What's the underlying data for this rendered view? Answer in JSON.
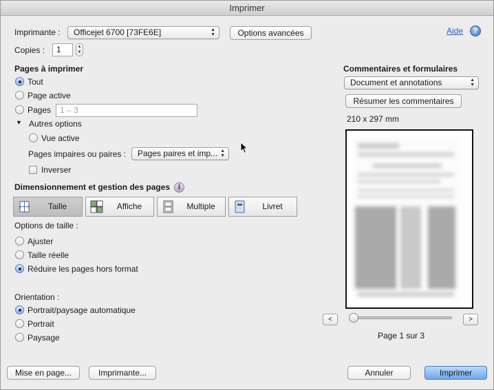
{
  "window": {
    "title": "Imprimer"
  },
  "printer": {
    "label": "Imprimante :",
    "selected": "Officejet 6700 [73FE6E]",
    "advanced_button": "Options avancées",
    "help_link": "Aide"
  },
  "copies": {
    "label": "Copies :",
    "value": "1"
  },
  "pages": {
    "heading": "Pages à imprimer",
    "all": "Tout",
    "current": "Page active",
    "range": "Pages",
    "range_placeholder": "1 – 3",
    "more_options": "Autres options",
    "active_view": "Vue active",
    "odd_even_label": "Pages impaires ou paires :",
    "odd_even_selected": "Pages paires et imp...",
    "reverse": "Inverser"
  },
  "sizing": {
    "heading": "Dimensionnement et gestion des pages",
    "modes": [
      "Taille",
      "Affiche",
      "Multiple",
      "Livret"
    ],
    "selected_mode": "Taille",
    "size_options_label": "Options de taille :",
    "fit": "Ajuster",
    "actual_size": "Taille réelle",
    "shrink_oversized": "Réduire les pages hors format"
  },
  "orientation": {
    "label": "Orientation :",
    "auto": "Portrait/paysage automatique",
    "portrait": "Portrait",
    "landscape": "Paysage"
  },
  "comments": {
    "heading": "Commentaires et formulaires",
    "selected": "Document et annotations",
    "summarize_button": "Résumer les commentaires",
    "page_size": "210 x 297 mm"
  },
  "preview": {
    "prev": "<",
    "next": ">",
    "page_status": "Page 1 sur 3",
    "current_page": 1,
    "total_pages": 3
  },
  "footer": {
    "page_setup": "Mise en page...",
    "printer": "Imprimante...",
    "cancel": "Annuler",
    "print": "Imprimer"
  },
  "colors": {
    "accent": "#6ea8ea",
    "link": "#2a5fc7"
  }
}
